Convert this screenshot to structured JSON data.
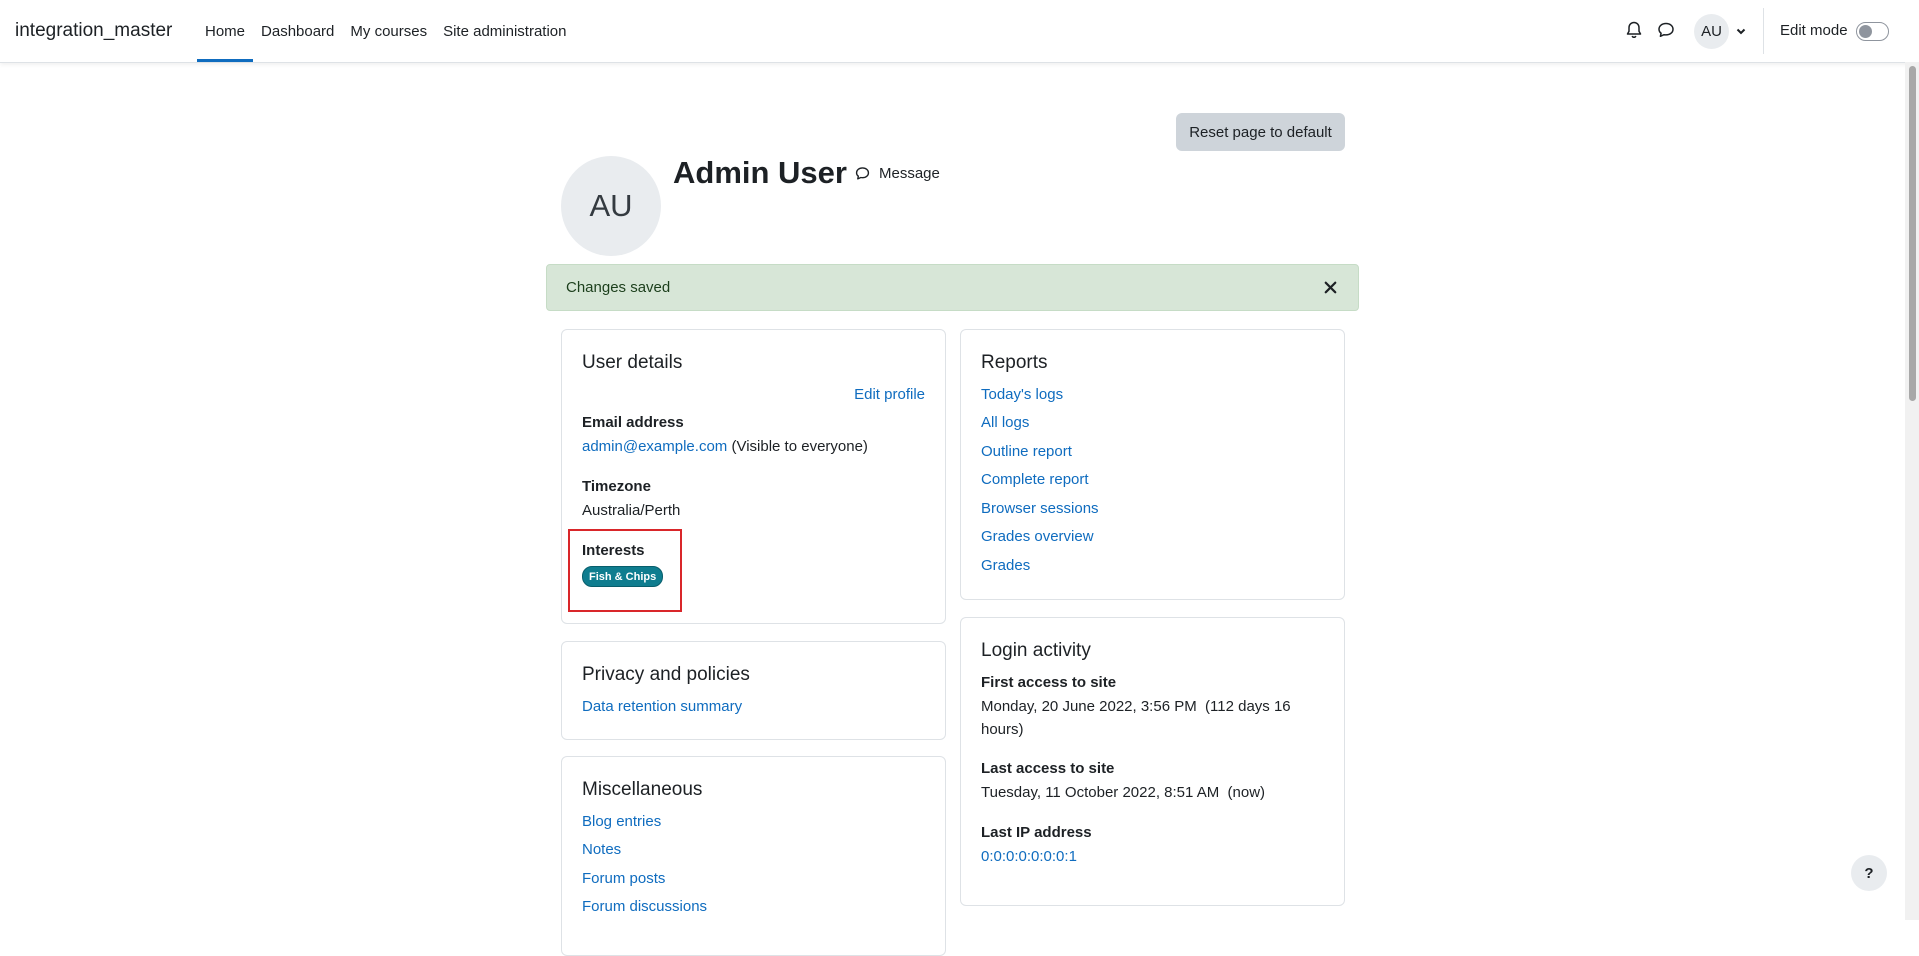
{
  "navbar": {
    "brand": "integration_master",
    "items": [
      {
        "label": "Home",
        "active": true
      },
      {
        "label": "Dashboard"
      },
      {
        "label": "My courses"
      },
      {
        "label": "Site administration"
      }
    ],
    "avatar_initials": "AU",
    "edit_mode_label": "Edit mode",
    "edit_mode_on": false
  },
  "header": {
    "reset_button": "Reset page to default",
    "avatar_initials": "AU",
    "user_name": "Admin User",
    "message_label": "Message"
  },
  "alert": {
    "text": "Changes saved",
    "close_glyph": "×"
  },
  "user_details": {
    "title": "User details",
    "edit_profile": "Edit profile",
    "email_label": "Email address",
    "email_value": "admin@example.com",
    "email_visibility": "(Visible to everyone)",
    "timezone_label": "Timezone",
    "timezone_value": "Australia/Perth",
    "interests_label": "Interests",
    "interests": [
      "Fish & Chips"
    ]
  },
  "privacy": {
    "title": "Privacy and policies",
    "links": [
      "Data retention summary"
    ]
  },
  "miscellaneous": {
    "title": "Miscellaneous",
    "links": [
      "Blog entries",
      "Notes",
      "Forum posts",
      "Forum discussions"
    ]
  },
  "reports": {
    "title": "Reports",
    "links": [
      "Today's logs",
      "All logs",
      "Outline report",
      "Complete report",
      "Browser sessions",
      "Grades overview",
      "Grades"
    ]
  },
  "login_activity": {
    "title": "Login activity",
    "first_access_label": "First access to site",
    "first_access_line1": "Monday, 20 June 2022, 3:56 PM  (112 days 16",
    "first_access_line2": "hours)",
    "last_access_label": "Last access to site",
    "last_access_value": "Tuesday, 11 October 2022, 8:51 AM  (now)",
    "last_ip_label": "Last IP address",
    "last_ip_value": "0:0:0:0:0:0:0:1"
  },
  "help_button": "?",
  "colors": {
    "link": "#0f6cbf",
    "alert_bg": "#d7e6d7",
    "badge": "#0f7d8f",
    "highlight": "#d9262a"
  }
}
